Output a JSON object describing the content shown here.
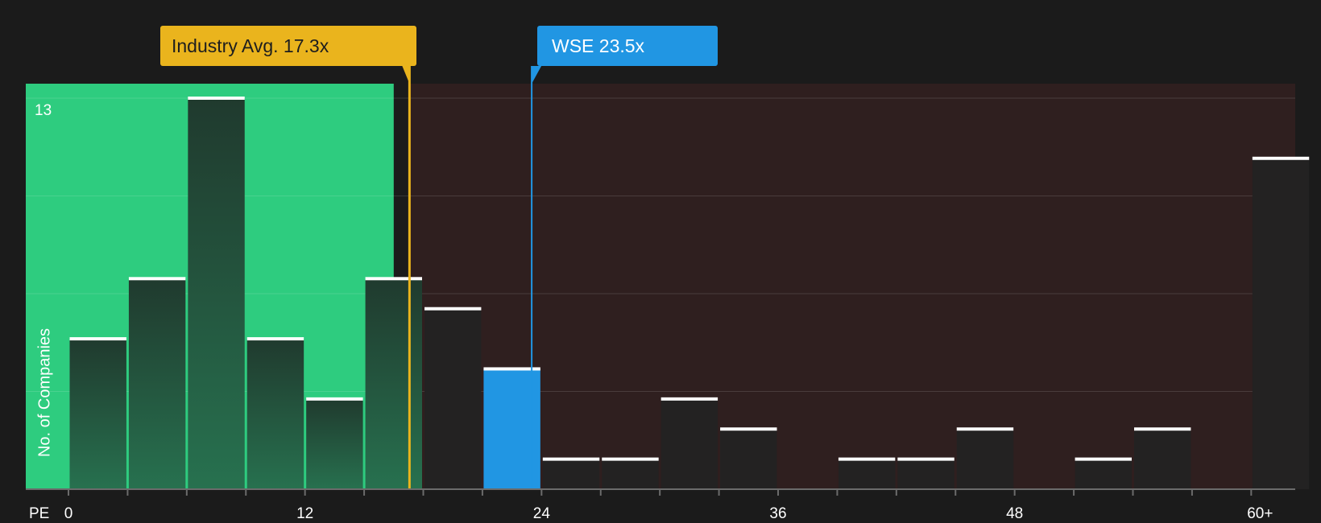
{
  "chart_data": {
    "type": "bar",
    "xlabel": "PE",
    "ylabel": "No. of Companies",
    "y_tick_label": "13",
    "ylim": [
      0,
      13
    ],
    "x_ticks": [
      "0",
      "12",
      "24",
      "36",
      "48",
      "60+"
    ],
    "x_range": [
      0,
      61.5
    ],
    "bin_width": 3,
    "bins": [
      {
        "x": 0,
        "count": 5
      },
      {
        "x": 3,
        "count": 7
      },
      {
        "x": 6,
        "count": 13
      },
      {
        "x": 9,
        "count": 5
      },
      {
        "x": 12,
        "count": 3
      },
      {
        "x": 15,
        "count": 7
      },
      {
        "x": 18,
        "count": 6
      },
      {
        "x": 21,
        "count": 4,
        "highlight": true
      },
      {
        "x": 24,
        "count": 1
      },
      {
        "x": 27,
        "count": 1
      },
      {
        "x": 30,
        "count": 3
      },
      {
        "x": 33,
        "count": 2
      },
      {
        "x": 36,
        "count": 0
      },
      {
        "x": 39,
        "count": 1
      },
      {
        "x": 42,
        "count": 1
      },
      {
        "x": 45,
        "count": 2
      },
      {
        "x": 48,
        "count": 0
      },
      {
        "x": 51,
        "count": 1
      },
      {
        "x": 54,
        "count": 2
      },
      {
        "x": 57,
        "count": 0
      },
      {
        "x": 60,
        "count": 11
      }
    ],
    "industry_avg": {
      "value": 17.3,
      "label": "Industry Avg. 17.3x"
    },
    "company": {
      "value": 23.5,
      "label": "WSE 23.5x"
    },
    "colors": {
      "background": "#1b1b1b",
      "undervalued_zone": "#2ecc7f",
      "overvalued_zone": "#2f1f1f",
      "bar": "#232222",
      "bar_in_green": "#1f4d38",
      "highlight_bar": "#2196e3",
      "bar_cap": "#ffffff",
      "industry_line": "#eab41d",
      "company_line": "#2196e3"
    }
  }
}
